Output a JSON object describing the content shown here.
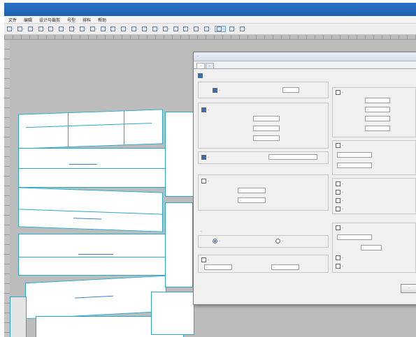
{
  "menu": {
    "items": [
      "文件",
      "编辑",
      "设计与裁剪",
      "号型",
      "排料",
      "帮助"
    ]
  },
  "toolbar": {
    "buttons": [
      "·",
      "·",
      "·",
      "·",
      "·",
      "·",
      "·",
      "·",
      "·",
      "·",
      "·",
      "·",
      "·",
      "·",
      "·",
      "·",
      "·",
      "·",
      "·",
      "·",
      "·",
      "·",
      "·"
    ],
    "active_index": 20
  },
  "dialog": {
    "title": "·",
    "tabs": [
      "·",
      "·"
    ],
    "label_placeholder": "·",
    "ok_label": "·"
  },
  "colors": {
    "accent": "#2aa9c4",
    "title": "#1e5fae",
    "work": "#bcbcbc"
  }
}
